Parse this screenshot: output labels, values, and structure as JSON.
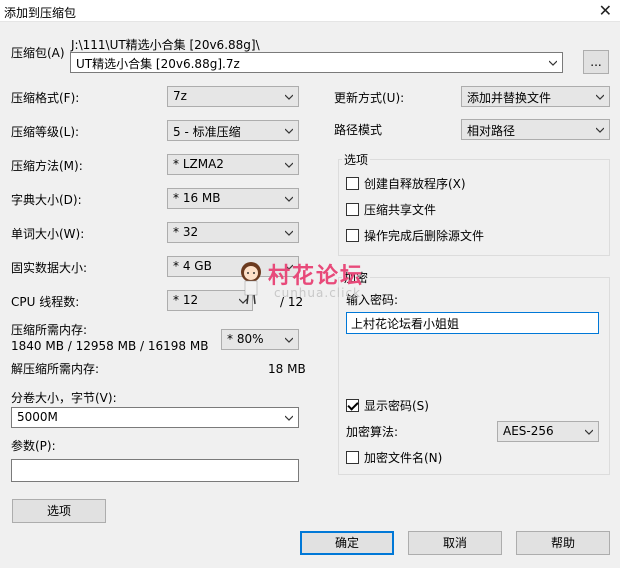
{
  "window": {
    "title": "添加到压缩包"
  },
  "archive": {
    "label": "压缩包(A)",
    "path": "J:\\111\\UT精选小合集 [20v6.88g]\\",
    "name": "UT精选小合集 [20v6.88g].7z",
    "browse_label": "..."
  },
  "left": {
    "format": {
      "label": "压缩格式(F):",
      "value": "7z"
    },
    "level": {
      "label": "压缩等级(L):",
      "value": "5 - 标准压缩"
    },
    "method": {
      "label": "压缩方法(M):",
      "value": "*  LZMA2"
    },
    "dict": {
      "label": "字典大小(D):",
      "value": "*  16 MB"
    },
    "word": {
      "label": "单词大小(W):",
      "value": "*  32"
    },
    "solid": {
      "label": "固实数据大小:",
      "value": "*  4 GB"
    },
    "cpu": {
      "label": "CPU 线程数:",
      "value": "*  12",
      "total": "/ 12"
    },
    "mem_compress": {
      "label": "压缩所需内存:",
      "detail": "1840 MB / 12958 MB / 16198 MB",
      "value": "*  80%"
    },
    "mem_decompress": {
      "label": "解压缩所需内存:",
      "value": "18 MB"
    },
    "split": {
      "label": "分卷大小，字节(V):",
      "value": "5000M"
    },
    "params": {
      "label": "参数(P):",
      "value": ""
    },
    "options_button": "选项"
  },
  "right": {
    "update": {
      "label": "更新方式(U):",
      "value": "添加并替换文件"
    },
    "path_mode": {
      "label": "路径模式",
      "value": "相对路径"
    },
    "options": {
      "title": "选项",
      "sfx": {
        "label": "创建自释放程序(X)",
        "checked": false
      },
      "shared": {
        "label": "压缩共享文件",
        "checked": false
      },
      "delete_after": {
        "label": "操作完成后删除源文件",
        "checked": false
      }
    },
    "encryption": {
      "title": "加密",
      "password_label": "输入密码:",
      "password": "上村花论坛看小姐姐",
      "show_password": {
        "label": "显示密码(S)",
        "checked": true
      },
      "method": {
        "label": "加密算法:",
        "value": "AES-256"
      },
      "encrypt_names": {
        "label": "加密文件名(N)",
        "checked": false
      }
    }
  },
  "buttons": {
    "ok": "确定",
    "cancel": "取消",
    "help": "帮助"
  },
  "watermark": {
    "text": "村花论坛",
    "sub": "cunhua.click"
  }
}
